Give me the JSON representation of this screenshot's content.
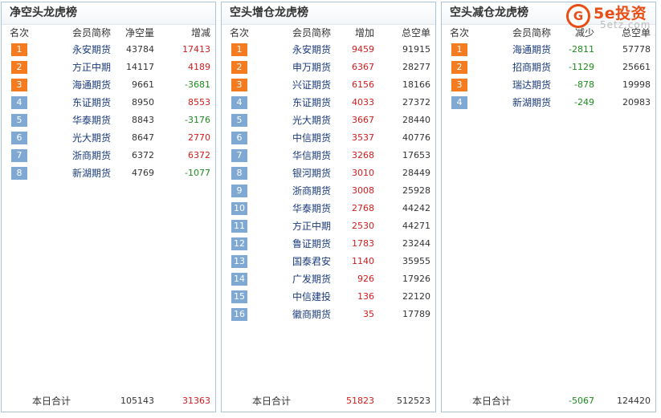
{
  "panels": [
    {
      "title": "净空头龙虎榜",
      "headers": [
        "名次",
        "会员简称",
        "净空量",
        "增减"
      ],
      "rows": [
        {
          "rank": "1",
          "name": "永安期货",
          "v1": "43784",
          "v2": "17413",
          "sign": "pos"
        },
        {
          "rank": "2",
          "name": "方正中期",
          "v1": "14117",
          "v2": "4189",
          "sign": "pos"
        },
        {
          "rank": "3",
          "name": "海通期货",
          "v1": "9661",
          "v2": "-3681",
          "sign": "neg"
        },
        {
          "rank": "4",
          "name": "东证期货",
          "v1": "8950",
          "v2": "8553",
          "sign": "pos"
        },
        {
          "rank": "5",
          "name": "华泰期货",
          "v1": "8843",
          "v2": "-3176",
          "sign": "neg"
        },
        {
          "rank": "6",
          "name": "光大期货",
          "v1": "8647",
          "v2": "2770",
          "sign": "pos"
        },
        {
          "rank": "7",
          "name": "浙商期货",
          "v1": "6372",
          "v2": "6372",
          "sign": "pos"
        },
        {
          "rank": "8",
          "name": "新湖期货",
          "v1": "4769",
          "v2": "-1077",
          "sign": "neg"
        }
      ],
      "total": {
        "label": "本日合计",
        "v1": "105143",
        "v2": "31363",
        "sign": "pos"
      }
    },
    {
      "title": "空头增仓龙虎榜",
      "headers": [
        "名次",
        "会员简称",
        "增加",
        "总空单"
      ],
      "rows": [
        {
          "rank": "1",
          "name": "永安期货",
          "v1": "9459",
          "v2": "91915",
          "sign": "inc"
        },
        {
          "rank": "2",
          "name": "申万期货",
          "v1": "6367",
          "v2": "28277",
          "sign": "inc"
        },
        {
          "rank": "3",
          "name": "兴证期货",
          "v1": "6156",
          "v2": "18166",
          "sign": "inc"
        },
        {
          "rank": "4",
          "name": "东证期货",
          "v1": "4033",
          "v2": "27372",
          "sign": "inc"
        },
        {
          "rank": "5",
          "name": "光大期货",
          "v1": "3667",
          "v2": "28440",
          "sign": "inc"
        },
        {
          "rank": "6",
          "name": "中信期货",
          "v1": "3537",
          "v2": "40776",
          "sign": "inc"
        },
        {
          "rank": "7",
          "name": "华信期货",
          "v1": "3268",
          "v2": "17653",
          "sign": "inc"
        },
        {
          "rank": "8",
          "name": "银河期货",
          "v1": "3010",
          "v2": "28449",
          "sign": "inc"
        },
        {
          "rank": "9",
          "name": "浙商期货",
          "v1": "3008",
          "v2": "25928",
          "sign": "inc"
        },
        {
          "rank": "10",
          "name": "华泰期货",
          "v1": "2768",
          "v2": "44242",
          "sign": "inc"
        },
        {
          "rank": "11",
          "name": "方正中期",
          "v1": "2530",
          "v2": "44271",
          "sign": "inc"
        },
        {
          "rank": "12",
          "name": "鲁证期货",
          "v1": "1783",
          "v2": "23244",
          "sign": "inc"
        },
        {
          "rank": "13",
          "name": "国泰君安",
          "v1": "1140",
          "v2": "35955",
          "sign": "inc"
        },
        {
          "rank": "14",
          "name": "广发期货",
          "v1": "926",
          "v2": "17926",
          "sign": "inc"
        },
        {
          "rank": "15",
          "name": "中信建投",
          "v1": "136",
          "v2": "22120",
          "sign": "inc"
        },
        {
          "rank": "16",
          "name": "徽商期货",
          "v1": "35",
          "v2": "17789",
          "sign": "inc"
        }
      ],
      "total": {
        "label": "本日合计",
        "v1": "51823",
        "v2": "512523",
        "sign": "inc"
      }
    },
    {
      "title": "空头减仓龙虎榜",
      "headers": [
        "名次",
        "会员简称",
        "减少",
        "总空单"
      ],
      "rows": [
        {
          "rank": "1",
          "name": "海通期货",
          "v1": "-2811",
          "v2": "57778",
          "sign": "dec"
        },
        {
          "rank": "2",
          "name": "招商期货",
          "v1": "-1129",
          "v2": "25661",
          "sign": "dec"
        },
        {
          "rank": "3",
          "name": "瑞达期货",
          "v1": "-878",
          "v2": "19998",
          "sign": "dec"
        },
        {
          "rank": "4",
          "name": "新湖期货",
          "v1": "-249",
          "v2": "20983",
          "sign": "dec"
        }
      ],
      "total": {
        "label": "本日合计",
        "v1": "-5067",
        "v2": "124420",
        "sign": "dec"
      }
    }
  ],
  "logo": {
    "mark": "G",
    "main": "5e投资",
    "sub": "5etz.com"
  },
  "colors": {
    "positive": "#d01c1c",
    "negative": "#1d8a1d",
    "rank_top": "#f47b20",
    "rank_other": "#7fa8d3",
    "border": "#aac3d9"
  }
}
